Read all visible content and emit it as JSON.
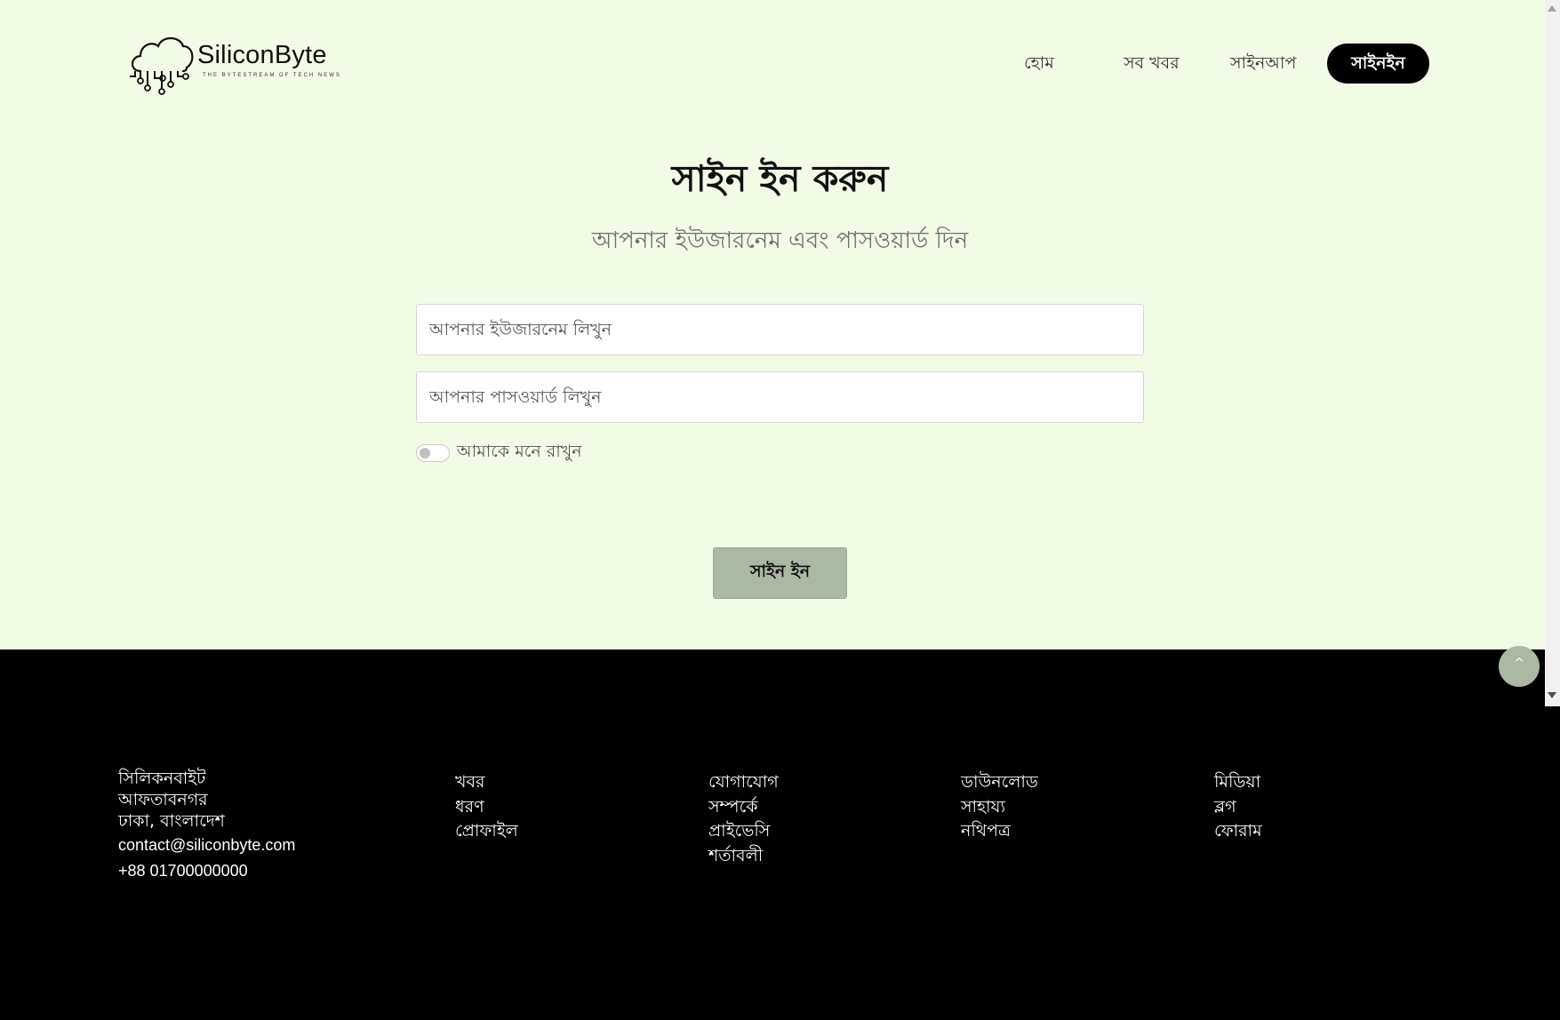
{
  "brand": {
    "name": "SiliconByte",
    "tagline": "THE   BYTESTREAM OF TECH   NEWS"
  },
  "nav": {
    "home": "হোম",
    "all_news": "সব খবর",
    "signup": "সাইনআপ",
    "signin": "সাইনইন"
  },
  "main": {
    "title": "সাইন ইন করুন",
    "subtitle": "আপনার ইউজারনেম এবং পাসওয়ার্ড দিন",
    "username_placeholder": "আপনার ইউজারনেম লিখুন",
    "password_placeholder": "আপনার পাসওয়ার্ড লিখুন",
    "remember_label": "আমাকে মনে রাখুন",
    "remember_checked": false,
    "submit_label": "সাইন ইন"
  },
  "footer": {
    "company": {
      "name": "সিলিকনবাইট",
      "area": "আফতাবনগর",
      "city": "ঢাকা, বাংলাদেশ",
      "email": "contact@siliconbyte.com",
      "phone": "+88 01700000000"
    },
    "col2": [
      "খবর",
      "ধরণ",
      "প্রোফাইল"
    ],
    "col3": [
      "যোগাযোগ",
      "সম্পর্কে",
      "প্রাইভেসি",
      "শর্তাবলী"
    ],
    "col4": [
      "ডাউনলোড",
      "সাহায্য",
      "নথিপত্র"
    ],
    "col5": [
      "মিডিয়া",
      "ব্লগ",
      "ফোরাম"
    ]
  },
  "back_to_top": "^",
  "colors": {
    "page_bg": "#f1fbe6",
    "accent_button": "#aab8a4",
    "footer_bg": "#000000"
  }
}
